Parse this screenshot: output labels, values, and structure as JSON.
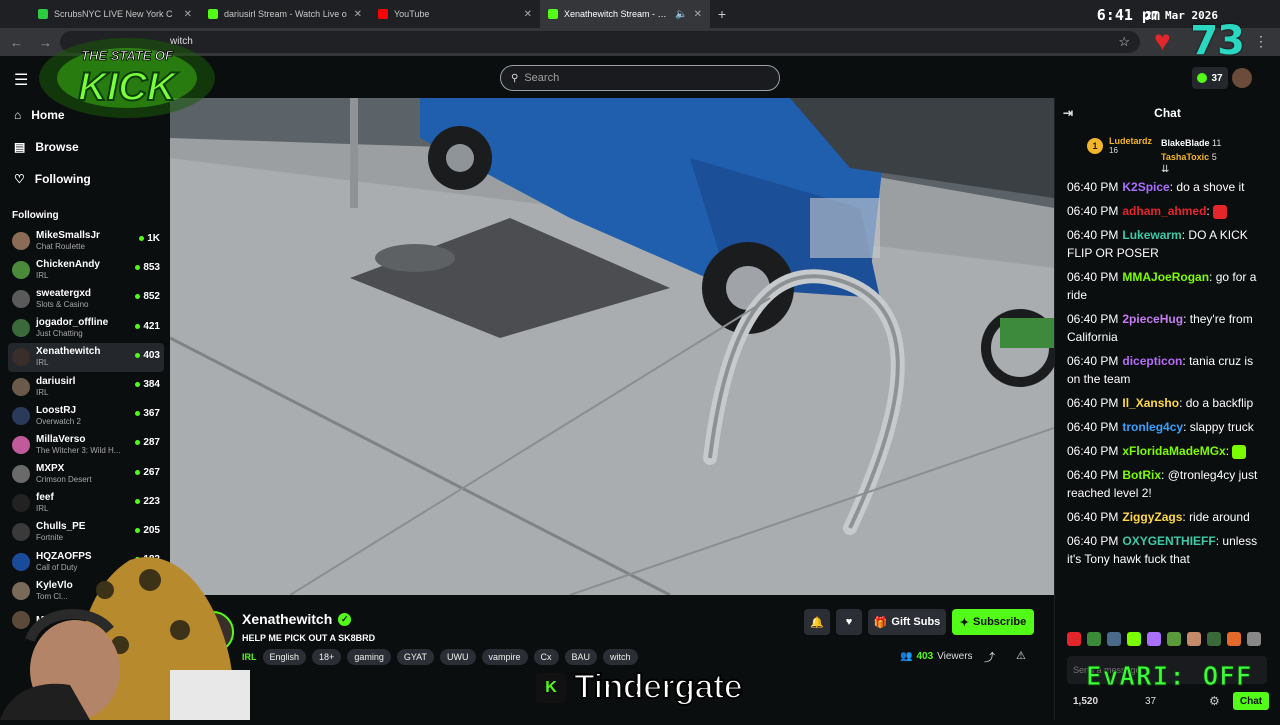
{
  "browser": {
    "tabs": [
      {
        "title": "ScrubsNYC LIVE New York C",
        "color": "#2ecc40"
      },
      {
        "title": "dariusirl Stream - Watch Live o",
        "color": "#53fc18"
      },
      {
        "title": "YouTube",
        "color": "#ff0000"
      },
      {
        "title": "Xenathewitch Stream - Watc",
        "color": "#53fc18",
        "active": true
      }
    ],
    "url_text": "witch",
    "clock_time": "6:41 pm",
    "clock_date": "27 Mar 2026",
    "overlay_number": "73"
  },
  "logo": {
    "line1": "THE STATE OF",
    "line2": "KICK"
  },
  "topnav": {
    "search_placeholder": "Search",
    "points": "37"
  },
  "sidebar": {
    "links": [
      {
        "label": "Home",
        "icon": "home-icon"
      },
      {
        "label": "Browse",
        "icon": "browse-icon"
      },
      {
        "label": "Following",
        "icon": "heart-icon"
      }
    ],
    "following_heading": "Following",
    "following": [
      {
        "name": "MikeSmallsJr",
        "category": "Chat Roulette",
        "viewers": "1K",
        "color": "#8a6b55"
      },
      {
        "name": "ChickenAndy",
        "category": "IRL",
        "viewers": "853",
        "color": "#4a8a3a"
      },
      {
        "name": "sweatergxd",
        "category": "Slots & Casino",
        "viewers": "852",
        "color": "#5a5a5a"
      },
      {
        "name": "jogador_offline",
        "category": "Just Chatting",
        "viewers": "421",
        "color": "#3a6a3a"
      },
      {
        "name": "Xenathewitch",
        "category": "IRL",
        "viewers": "403",
        "color": "#3a2e2a",
        "active": true
      },
      {
        "name": "dariusirl",
        "category": "IRL",
        "viewers": "384",
        "color": "#6a5a4a"
      },
      {
        "name": "LoostRJ",
        "category": "Overwatch 2",
        "viewers": "367",
        "color": "#2a3a5a"
      },
      {
        "name": "MillaVerso",
        "category": "The Witcher 3: Wild H...",
        "viewers": "287",
        "color": "#c05a9a"
      },
      {
        "name": "MXPX",
        "category": "Crimson Desert",
        "viewers": "267",
        "color": "#6a6a6a"
      },
      {
        "name": "feef",
        "category": "IRL",
        "viewers": "223",
        "color": "#222222"
      },
      {
        "name": "Chulls_PE",
        "category": "Fortnite",
        "viewers": "205",
        "color": "#3a3a3a"
      },
      {
        "name": "HQZAOFPS",
        "category": "Call of Duty",
        "viewers": "182",
        "color": "#1a4a9a"
      },
      {
        "name": "KyleVlo",
        "category": "Tom Cl...",
        "viewers": "",
        "color": "#7a6a5a"
      },
      {
        "name": "Mo",
        "category": "",
        "viewers": "",
        "color": "#5a4a3a"
      }
    ]
  },
  "stream": {
    "streamer": "Xenathewitch",
    "title": "HELP ME PICK OUT A SK8BRD",
    "category": "IRL",
    "tags": [
      "English",
      "18+",
      "gaming",
      "GYAT",
      "UWU",
      "vampire",
      "Cx",
      "BAU",
      "witch"
    ],
    "gift_label": "Gift Subs",
    "subscribe_label": "Subscribe",
    "viewers": "403",
    "viewers_label": "Viewers"
  },
  "chat": {
    "header": "Chat",
    "leaderboard": {
      "top": {
        "rank": "1",
        "name": "Ludetardz",
        "count": "16"
      },
      "others": [
        {
          "name": "BlakeBlade",
          "count": "11",
          "color": "#ffffff"
        },
        {
          "name": "TashaToxic",
          "count": "5",
          "color": "#f3b52b"
        }
      ]
    },
    "messages": [
      {
        "time": "06:40 PM",
        "user": "K2Spice",
        "color": "#a970ff",
        "text": "do a shove it"
      },
      {
        "time": "06:40 PM",
        "user": "adham_ahmed",
        "color": "#e3262b",
        "text": ""
      },
      {
        "time": "06:40 PM",
        "user": "Lukewarm",
        "color": "#3ec9a7",
        "text": "DO A KICK FLIP OR POSER"
      },
      {
        "time": "06:40 PM",
        "user": "MMAJoeRogan",
        "color": "#7cfc00",
        "text": "go for a ride"
      },
      {
        "time": "06:40 PM",
        "user": "2pieceHug",
        "color": "#c47cf2",
        "text": "they're from California"
      },
      {
        "time": "06:40 PM",
        "user": "dicepticon",
        "color": "#b46cf5",
        "text": "tania cruz is on the team"
      },
      {
        "time": "06:40 PM",
        "user": "Il_Xansho",
        "color": "#ffd84a",
        "text": "do a backflip"
      },
      {
        "time": "06:40 PM",
        "user": "tronleg4cy",
        "color": "#3aa0ff",
        "text": "slappy truck"
      },
      {
        "time": "06:40 PM",
        "user": "xFloridaMadeMGx",
        "color": "#7cfc00",
        "text": ""
      },
      {
        "time": "06:40 PM",
        "user": "BotRix",
        "color": "#7cfc00",
        "text": "@tronleg4cy just reached level 2!"
      },
      {
        "time": "06:40 PM",
        "user": "ZiggyZags",
        "color": "#ffd84a",
        "text": "ride around"
      },
      {
        "time": "06:40 PM",
        "user": "OXYGENTHIEFF",
        "color": "#3ec9a7",
        "text": "unless it's Tony hawk fuck that"
      }
    ],
    "input_placeholder": "Send a message",
    "footer_points": "1,520",
    "footer_count": "37",
    "chat_button": "Chat"
  },
  "overlays": {
    "caption": "Tindergate",
    "caption_badge": "K",
    "evari": "EvARI: OFF"
  }
}
